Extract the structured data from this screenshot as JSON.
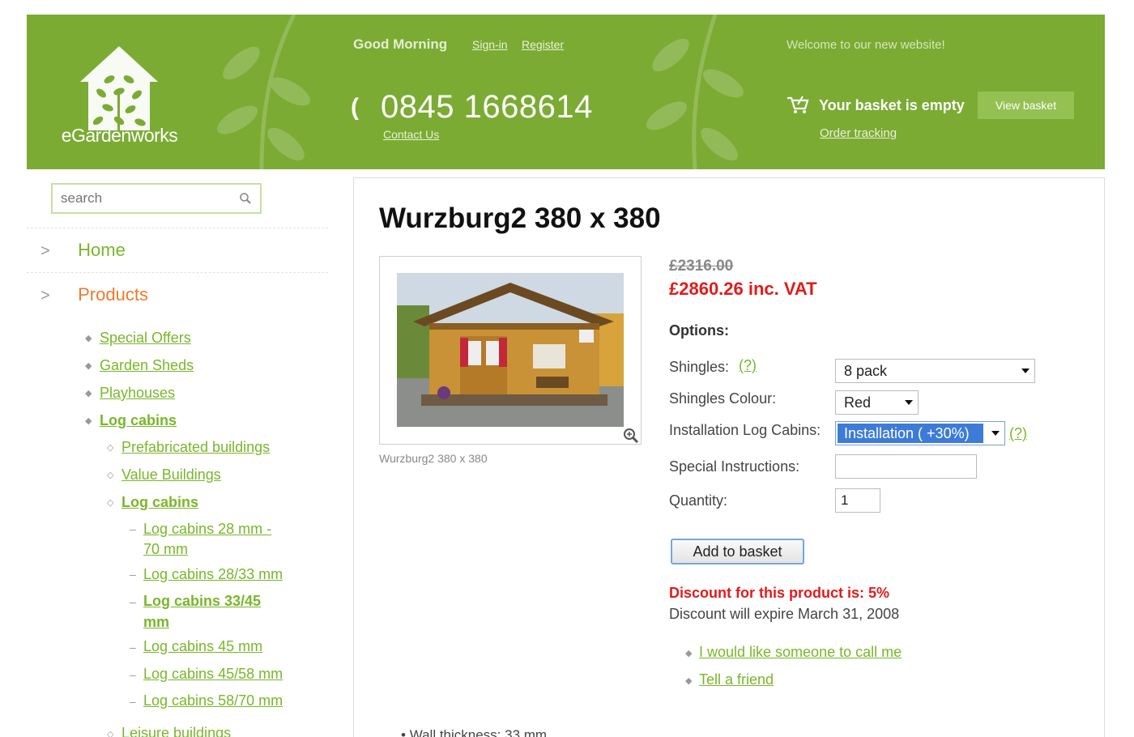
{
  "header": {
    "brand": "eGardenworks",
    "greeting": "Good Morning",
    "signin": "Sign-in",
    "register": "Register",
    "phone": "0845 1668614",
    "contact": "Contact Us",
    "welcome": "Welcome to our new website!",
    "basket_status": "Your basket is empty",
    "view_basket": "View basket",
    "order_tracking": "Order tracking",
    "color": "#7bab33"
  },
  "search": {
    "placeholder": "search"
  },
  "nav": {
    "home": "Home",
    "products": "Products",
    "level1": [
      "Special Offers",
      "Garden Sheds",
      "Playhouses",
      "Log cabins"
    ],
    "level2": [
      "Prefabricated buildings",
      "Value Buildings",
      "Log cabins"
    ],
    "level3": [
      "Log cabins 28 mm -",
      "70 mm",
      "Log cabins 28/33 mm",
      "Log cabins 33/45",
      "mm",
      "Log cabins 45 mm",
      "Log cabins 45/58 mm",
      "Log cabins 58/70 mm"
    ],
    "level2_bottom": "Leisure buildings"
  },
  "product": {
    "title": "Wurzburg2 380 x 380",
    "image_caption": "Wurzburg2 380 x 380",
    "old_price": "£2316.00",
    "new_price": "£2860.26 inc. VAT",
    "options_heading": "Options:",
    "shingles_label": "Shingles:",
    "shingles_value": "8 pack",
    "help": "(?)",
    "colour_label": "Shingles Colour:",
    "colour_value": "Red",
    "install_label": "Installation Log Cabins:",
    "install_value": "Installation ( +30%)",
    "instructions_label": "Special Instructions:",
    "quantity_label": "Quantity:",
    "quantity_value": "1",
    "add_button": "Add to basket",
    "discount": "Discount for this product is: 5%",
    "discount_expiry": "Discount will expire March 31, 2008",
    "call_me": "I would like someone to call me",
    "tell_friend": "Tell a friend",
    "spec_partial": "Wall thickness: 33 mm",
    "price_color": "#e21b1b",
    "link_color": "#7ab62a"
  }
}
